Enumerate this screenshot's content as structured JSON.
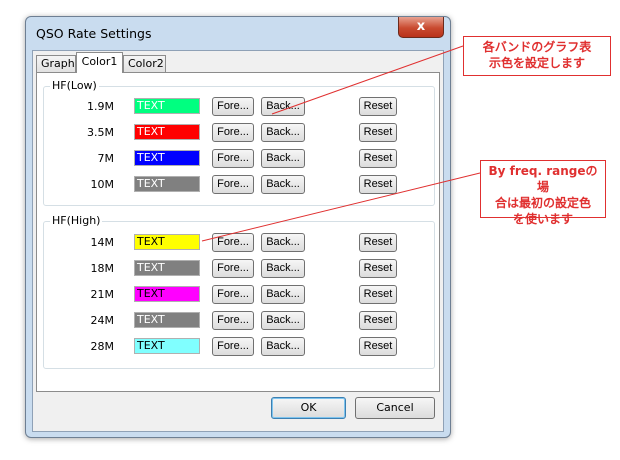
{
  "window": {
    "title": "QSO Rate Settings",
    "close_glyph": "x"
  },
  "tabs": [
    {
      "label": "Graph",
      "active": false
    },
    {
      "label": "Color1",
      "active": true
    },
    {
      "label": "Color2",
      "active": false
    }
  ],
  "buttons": {
    "fore": "Fore...",
    "back": "Back...",
    "reset": "Reset"
  },
  "groups": {
    "low": {
      "title": "HF(Low)",
      "rows": [
        {
          "band": "1.9M",
          "text": "TEXT",
          "bg": "#00ff80",
          "fg": "#ffffff"
        },
        {
          "band": "3.5M",
          "text": "TEXT",
          "bg": "#ff0000",
          "fg": "#ffffff"
        },
        {
          "band": "7M",
          "text": "TEXT",
          "bg": "#0000ff",
          "fg": "#ffffff"
        },
        {
          "band": "10M",
          "text": "TEXT",
          "bg": "#808080",
          "fg": "#ffffff"
        }
      ]
    },
    "high": {
      "title": "HF(High)",
      "rows": [
        {
          "band": "14M",
          "text": "TEXT",
          "bg": "#ffff00",
          "fg": "#000000"
        },
        {
          "band": "18M",
          "text": "TEXT",
          "bg": "#808080",
          "fg": "#ffffff"
        },
        {
          "band": "21M",
          "text": "TEXT",
          "bg": "#ff00ff",
          "fg": "#000000"
        },
        {
          "band": "24M",
          "text": "TEXT",
          "bg": "#808080",
          "fg": "#ffffff"
        },
        {
          "band": "28M",
          "text": "TEXT",
          "bg": "#80ffff",
          "fg": "#000000"
        }
      ]
    }
  },
  "footer": {
    "ok": "OK",
    "cancel": "Cancel"
  },
  "callouts": {
    "top": {
      "line1": "各バンドのグラフ表",
      "line2": "示色を設定します"
    },
    "bottom": {
      "line1": "By freq. rangeの場",
      "line2": "合は最初の設定色",
      "line3": "を使います"
    }
  },
  "colors": {
    "callout": "#e03030",
    "window_frame": "#c9dcef"
  }
}
